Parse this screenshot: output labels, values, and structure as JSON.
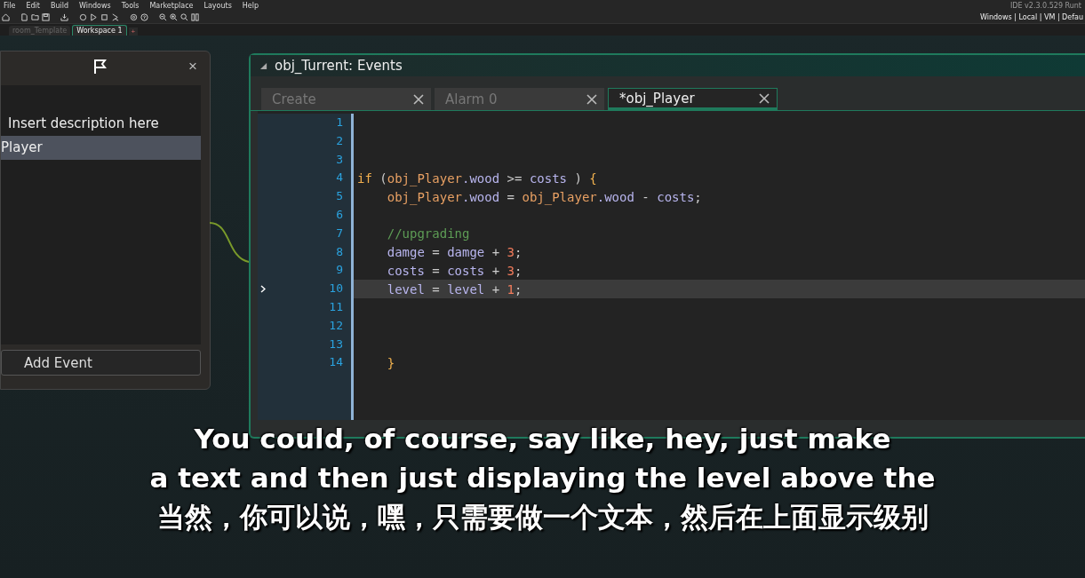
{
  "menu_bar": {
    "items": [
      "File",
      "Edit",
      "Build",
      "Windows",
      "Tools",
      "Marketplace",
      "Layouts",
      "Help"
    ],
    "version": "IDE v2.3.0.529 Runt"
  },
  "toolbar": {
    "targets": "Windows | Local | VM | Defau"
  },
  "workspace_tabs": [
    {
      "label": "room_Template",
      "selected": false
    },
    {
      "label": "Workspace 1",
      "selected": true
    }
  ],
  "add_tab": "+",
  "event_list_panel": {
    "items": [
      {
        "label": "Insert description here",
        "selected": false
      },
      {
        "label": "Player",
        "selected": true
      }
    ],
    "add_button": "Add Event",
    "close": "×"
  },
  "events_window": {
    "title": "obj_Turrent: Events",
    "tabs": [
      {
        "label": "Create",
        "selected": false
      },
      {
        "label": "Alarm 0",
        "selected": false
      },
      {
        "label": "*obj_Player",
        "selected": true
      }
    ],
    "lines": [
      {
        "number": "1",
        "current": false
      },
      {
        "number": "2",
        "current": false
      },
      {
        "number": "3",
        "current": false
      },
      {
        "number": "4",
        "current": false,
        "indented": false,
        "tokens": [
          {
            "kind": "keyword",
            "text": "if"
          },
          {
            "kind": "punct",
            "text": " ("
          },
          {
            "kind": "object",
            "text": "obj_Player"
          },
          {
            "kind": "field",
            "text": ".wood"
          },
          {
            "kind": "punct",
            "text": " >= "
          },
          {
            "kind": "field",
            "text": "costs"
          },
          {
            "kind": "punct",
            "text": " ) "
          },
          {
            "kind": "brace",
            "text": "{"
          }
        ]
      },
      {
        "number": "5",
        "current": false,
        "indented": true,
        "tokens": [
          {
            "kind": "object",
            "text": "obj_Player"
          },
          {
            "kind": "field",
            "text": ".wood"
          },
          {
            "kind": "punct",
            "text": " = "
          },
          {
            "kind": "object",
            "text": "obj_Player"
          },
          {
            "kind": "field",
            "text": ".wood"
          },
          {
            "kind": "punct",
            "text": " - "
          },
          {
            "kind": "field",
            "text": "costs"
          },
          {
            "kind": "punct",
            "text": ";"
          }
        ]
      },
      {
        "number": "6",
        "current": false
      },
      {
        "number": "7",
        "current": false,
        "indented": true,
        "tokens": [
          {
            "kind": "comment",
            "text": "//upgrading"
          }
        ]
      },
      {
        "number": "8",
        "current": false,
        "indented": true,
        "tokens": [
          {
            "kind": "field",
            "text": "damge"
          },
          {
            "kind": "punct",
            "text": " = "
          },
          {
            "kind": "field",
            "text": "damge"
          },
          {
            "kind": "punct",
            "text": " + "
          },
          {
            "kind": "number",
            "text": "3"
          },
          {
            "kind": "punct",
            "text": ";"
          }
        ]
      },
      {
        "number": "9",
        "current": false,
        "indented": true,
        "tokens": [
          {
            "kind": "field",
            "text": "costs"
          },
          {
            "kind": "punct",
            "text": " = "
          },
          {
            "kind": "field",
            "text": "costs"
          },
          {
            "kind": "punct",
            "text": " + "
          },
          {
            "kind": "number",
            "text": "3"
          },
          {
            "kind": "punct",
            "text": ";"
          }
        ]
      },
      {
        "number": "10",
        "current": true,
        "indented": true,
        "tokens": [
          {
            "kind": "field",
            "text": "level"
          },
          {
            "kind": "punct",
            "text": " = "
          },
          {
            "kind": "field",
            "text": "level"
          },
          {
            "kind": "punct",
            "text": " + "
          },
          {
            "kind": "number",
            "text": "1"
          },
          {
            "kind": "punct",
            "text": ";"
          }
        ]
      },
      {
        "number": "11",
        "current": false
      },
      {
        "number": "12",
        "current": false
      },
      {
        "number": "13",
        "current": false
      },
      {
        "number": "14",
        "current": false,
        "indented": true,
        "tokens": [
          {
            "kind": "brace",
            "text": "}"
          }
        ]
      }
    ]
  },
  "subtitles": [
    "You could, of course, say like, hey, just make",
    "a text and then just displaying the level above the",
    "当然，你可以说，嘿，只需要做一个文本，然后在上面显示级别"
  ]
}
